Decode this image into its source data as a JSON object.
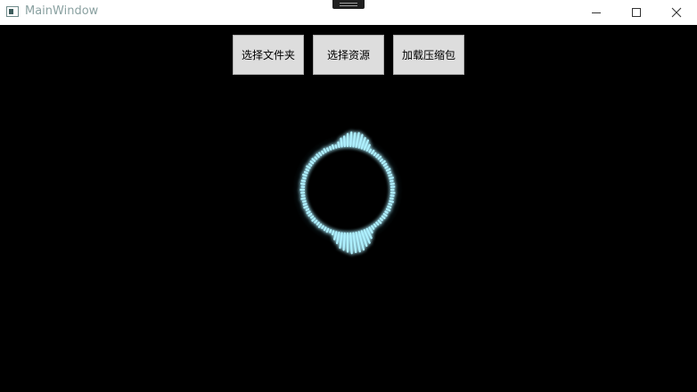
{
  "window": {
    "title": "MainWindow",
    "icon": "app-window-icon",
    "controls": [
      "minimize-icon",
      "maximize-icon",
      "close-icon"
    ]
  },
  "toolbar": {
    "select_folder_label": "选择文件夹",
    "select_resource_label": "选择资源",
    "load_archive_label": "加载压缩包"
  },
  "visualizer": {
    "type": "circular-audio-spectrum",
    "color": "#aef0ff",
    "glow_color": "#5fd8ff",
    "background": "#000000"
  }
}
